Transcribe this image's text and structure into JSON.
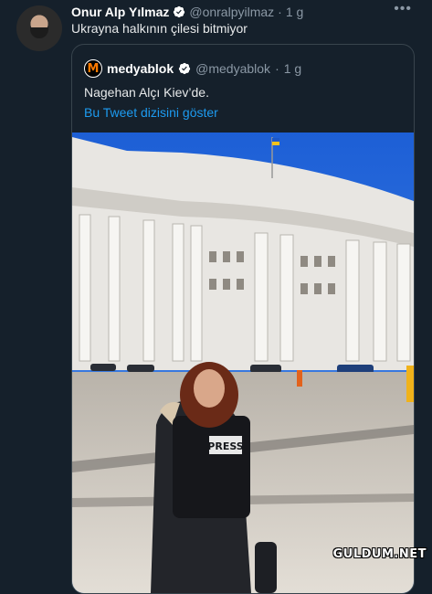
{
  "tweet": {
    "author_name": "Onur Alp Yılmaz",
    "author_handle": "@onralpyilmaz",
    "time": "1 g",
    "separator": "·",
    "text": "Ukrayna halkının çilesi bitmiyor",
    "more_icon": "more-horizontal-icon"
  },
  "quoted_tweet": {
    "author_name": "medyablok",
    "author_handle": "@medyablok",
    "time": "1 g",
    "separator": "·",
    "logo_letter": "M",
    "text": "Nagehan Alçı Kiev’de.",
    "show_thread_label": "Bu Tweet dizisini göster",
    "image_press_label": "PRESS"
  },
  "watermark": "GULDUM.NET",
  "colors": {
    "background": "#15202b",
    "link": "#1d9bf0",
    "verified": "#ffffff",
    "muted": "#8b98a5"
  }
}
